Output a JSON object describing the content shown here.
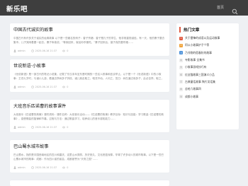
{
  "header": {
    "site_name": "新乐吧",
    "nav_home": "首页"
  },
  "posts": [
    {
      "title": "中国古代诚实的故事",
      "excerpt": "中国古代有许多关于诚实的经典故事 以下是一些著名的例子：曾子杀猪：曾子是孔子的学生，他非常重视诚信。有一天，他的妻子要去集市，儿子哭闹着要一起去。妻子哄他说，“等我回来，就给你杀猪吃。”妻子回来后，曾子真的要杀猪……",
      "author": "admin",
      "date": "2025-06-16 21:37",
      "views": "0"
    },
    {
      "title": "世说新语·小故事",
      "excerpt": "《世说新语》是一部古代的笔记小说集，记载了东汉末年至东晋时期的一些名人轶事和言谈举止。以下是一个《世说新语》中的小故事：王戎七岁时，与诸小儿游，看道边李树多子折枝，诸儿竞走取之，唯戎不动。人问之，答曰：树在道边而多子，此必苦李。取之，信然……",
      "author": "admin",
      "date": "2025-06-16 21:37",
      "views": "0"
    },
    {
      "title": "大班音乐匹诺曹的故事课件",
      "excerpt": "大班音乐《匹诺曹的故事》课件资料：课件名称：大班音乐活动——《匹诺曹的故事》教学目标：知识与技能：学习歌曲《匹诺曹的故事》，感受歌曲的旋律和节奏。过程与方法：通过歌曲学习，培养幼儿的音乐感知能力……",
      "author": "admin",
      "date": "2025-06-16 21:37",
      "views": "0"
    },
    {
      "title": "巴山蜀水城市故事",
      "excerpt": "巴山蜀水，指的是中国西南地区的四川和重庆，这里山水秀丽，历史悠久，文化底蕴深厚。孕育了许多动人的城市故事。以下是一些巴山蜀水城市的故事：成都：作为四川省的省会，成都被誉为“天府之国”……",
      "author": "admin",
      "date": "2025-06-16 21:37",
      "views": "0"
    },
    {
      "title": "",
      "excerpt": "",
      "author": "",
      "date": "",
      "views": ""
    }
  ],
  "sidebar": {
    "title": "热门文章",
    "items": [
      {
        "num": "1",
        "label": "关于雷锋的成语以及运动故事",
        "color": "#e15a41"
      },
      {
        "num": "2",
        "label": "阿以小故事护子个等",
        "color": "#f0a33a"
      },
      {
        "num": "3",
        "label": "乃邻侧的宿春秋的故事",
        "color": "#4a90d9"
      },
      {
        "num": "4",
        "label": "寺影故事 全集书",
        "color": ""
      },
      {
        "num": "5",
        "label": "小故事游戏技巧有",
        "color": ""
      },
      {
        "num": "6",
        "label": "红丝猫故事三国演义小品",
        "color": ""
      },
      {
        "num": "7",
        "label": "古典童话故事 陶片笑话集",
        "color": ""
      },
      {
        "num": "8",
        "label": "苦哈六故事四",
        "color": ""
      },
      {
        "num": "9",
        "label": "成都小故事",
        "color": ""
      }
    ]
  },
  "colors": {
    "header_bg": "#3e3e3e",
    "accent": "#e15a41"
  }
}
